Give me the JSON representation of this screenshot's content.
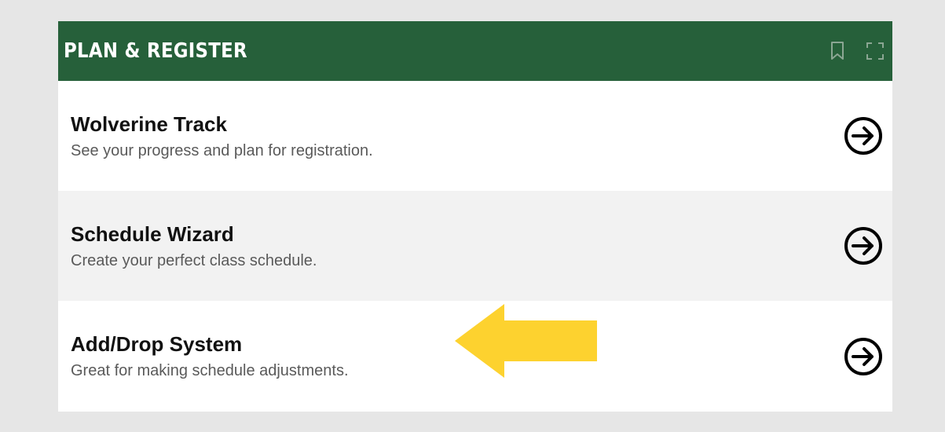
{
  "header": {
    "title": "PLAN & REGISTER",
    "bookmark_icon": "bookmark-icon",
    "expand_icon": "expand-icon"
  },
  "items": [
    {
      "title": "Wolverine Track",
      "description": "See your progress and plan for registration.",
      "icon": "arrow-circle-right-icon"
    },
    {
      "title": "Schedule Wizard",
      "description": "Create your perfect class schedule.",
      "icon": "arrow-circle-right-icon"
    },
    {
      "title": "Add/Drop System",
      "description": "Great for making schedule adjustments.",
      "icon": "arrow-circle-right-icon"
    }
  ],
  "annotation": {
    "icon": "yellow-pointer-arrow",
    "points_to": "Add/Drop System"
  },
  "colors": {
    "header_bg": "#26603a",
    "page_bg": "#e6e6e6",
    "alt_row_bg": "#f2f2f2",
    "annotation_arrow": "#fdd22f"
  }
}
